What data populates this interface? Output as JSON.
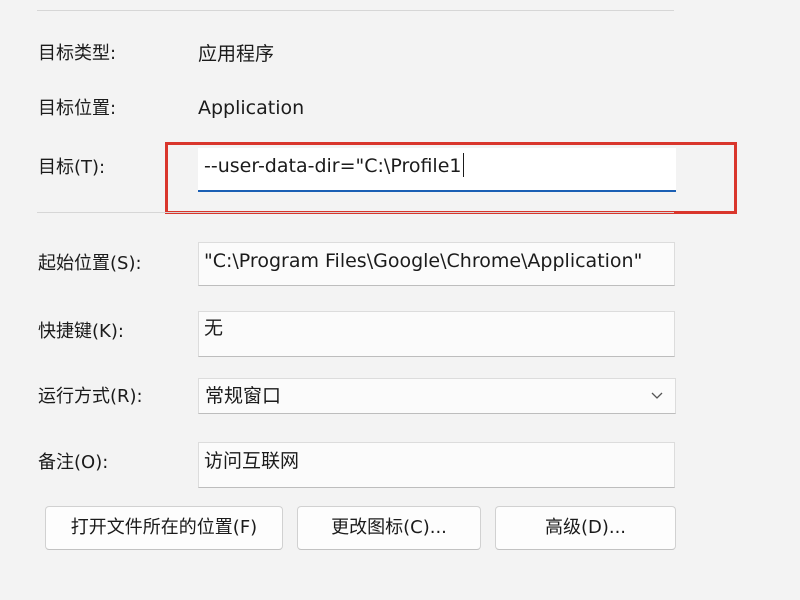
{
  "fields": {
    "target_type": {
      "label": "目标类型:",
      "value": "应用程序"
    },
    "target_location": {
      "label": "目标位置:",
      "value": "Application"
    },
    "target": {
      "label": "目标(T):",
      "value": "--user-data-dir=\"C:\\Profile1"
    },
    "start_in": {
      "label": "起始位置(S):",
      "value": "\"C:\\Program Files\\Google\\Chrome\\Application\""
    },
    "shortcut_key": {
      "label": "快捷键(K):",
      "value": "无"
    },
    "run": {
      "label": "运行方式(R):",
      "value": "常规窗口"
    },
    "comment": {
      "label": "备注(O):",
      "value": "访问互联网"
    }
  },
  "buttons": {
    "open_location": "打开文件所在的位置(F)",
    "change_icon": "更改图标(C)...",
    "advanced": "高级(D)..."
  },
  "colors": {
    "highlight": "#d9362c",
    "focus_underline": "#1a5fb4"
  }
}
